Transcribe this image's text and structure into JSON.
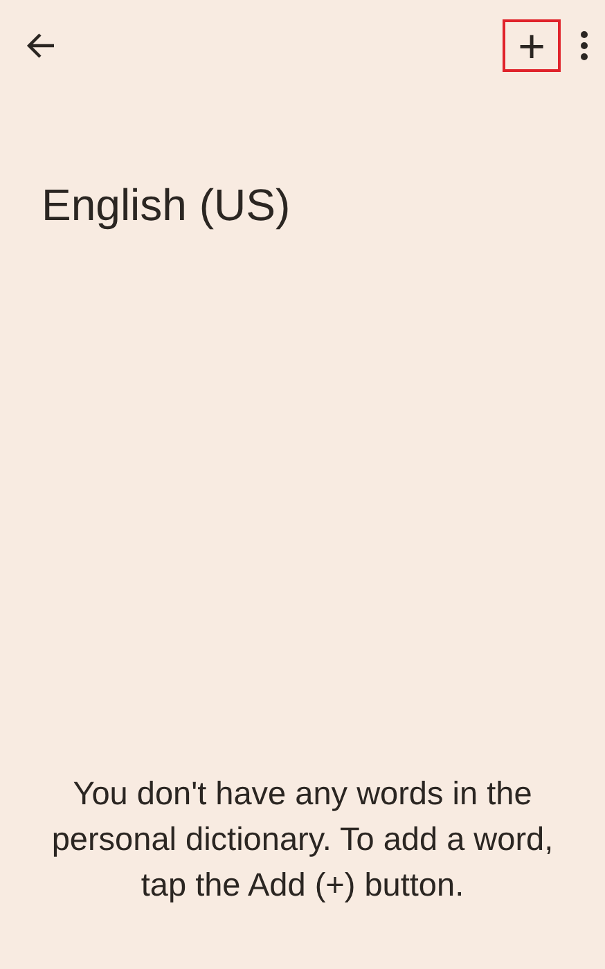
{
  "toolbar": {
    "add_button": {
      "label": "+",
      "highlighted": true
    }
  },
  "title": "English (US)",
  "empty_message": "You don't have any words in the personal dictionary. To add a word, tap the Add (+) button."
}
